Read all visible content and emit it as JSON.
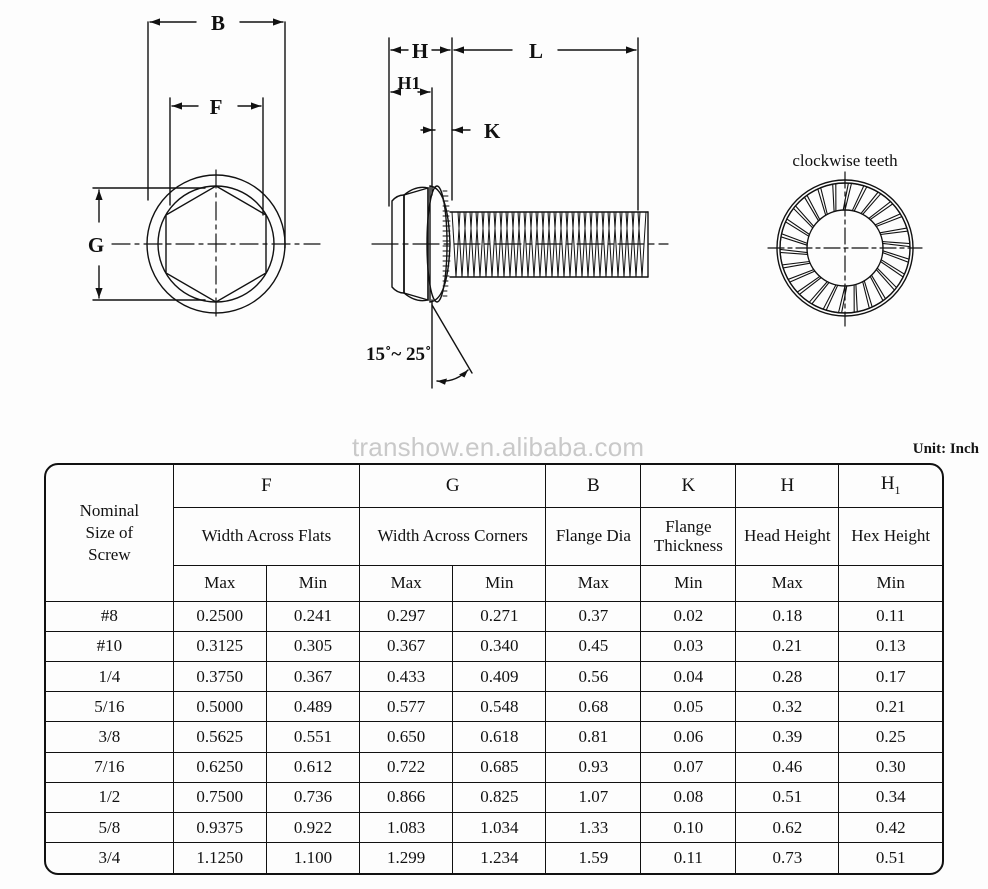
{
  "watermark": "transhow.en.alibaba.com",
  "unit_note": "Unit: Inch",
  "drawing": {
    "top_view": {
      "dim_b": "B",
      "dim_f": "F",
      "dim_g": "G"
    },
    "side_view": {
      "dim_h": "H",
      "dim_h1": "H1",
      "dim_l": "L",
      "dim_k": "K",
      "angle": "15˚~ 25˚"
    },
    "bottom_view": {
      "caption": "clockwise teeth"
    }
  },
  "table": {
    "symbols": [
      "",
      "F",
      "G",
      "B",
      "K",
      "H",
      "H1"
    ],
    "names": [
      "Nominal Size of Screw",
      "Width Across Flats",
      "Width Across Corners",
      "Flange Dia",
      "Flange Thickness",
      "Head Height",
      "Hex Height"
    ],
    "nominal_lines": [
      "Nominal",
      "Size of",
      "Screw"
    ],
    "flange_thickness_lines": [
      "Flange",
      "Thickness"
    ],
    "minmax": [
      "Max",
      "Min",
      "Max",
      "Min",
      "Max",
      "Min",
      "Max",
      "Min"
    ],
    "rows": [
      {
        "size": "#8",
        "f_max": "0.2500",
        "f_min": "0.241",
        "g_max": "0.297",
        "g_min": "0.271",
        "b_max": "0.37",
        "k_min": "0.02",
        "h_max": "0.18",
        "h1_min": "0.11"
      },
      {
        "size": "#10",
        "f_max": "0.3125",
        "f_min": "0.305",
        "g_max": "0.367",
        "g_min": "0.340",
        "b_max": "0.45",
        "k_min": "0.03",
        "h_max": "0.21",
        "h1_min": "0.13"
      },
      {
        "size": "1/4",
        "f_max": "0.3750",
        "f_min": "0.367",
        "g_max": "0.433",
        "g_min": "0.409",
        "b_max": "0.56",
        "k_min": "0.04",
        "h_max": "0.28",
        "h1_min": "0.17"
      },
      {
        "size": "5/16",
        "f_max": "0.5000",
        "f_min": "0.489",
        "g_max": "0.577",
        "g_min": "0.548",
        "b_max": "0.68",
        "k_min": "0.05",
        "h_max": "0.32",
        "h1_min": "0.21"
      },
      {
        "size": "3/8",
        "f_max": "0.5625",
        "f_min": "0.551",
        "g_max": "0.650",
        "g_min": "0.618",
        "b_max": "0.81",
        "k_min": "0.06",
        "h_max": "0.39",
        "h1_min": "0.25"
      },
      {
        "size": "7/16",
        "f_max": "0.6250",
        "f_min": "0.612",
        "g_max": "0.722",
        "g_min": "0.685",
        "b_max": "0.93",
        "k_min": "0.07",
        "h_max": "0.46",
        "h1_min": "0.30"
      },
      {
        "size": "1/2",
        "f_max": "0.7500",
        "f_min": "0.736",
        "g_max": "0.866",
        "g_min": "0.825",
        "b_max": "1.07",
        "k_min": "0.08",
        "h_max": "0.51",
        "h1_min": "0.34"
      },
      {
        "size": "5/8",
        "f_max": "0.9375",
        "f_min": "0.922",
        "g_max": "1.083",
        "g_min": "1.034",
        "b_max": "1.33",
        "k_min": "0.10",
        "h_max": "0.62",
        "h1_min": "0.42"
      },
      {
        "size": "3/4",
        "f_max": "1.1250",
        "f_min": "1.100",
        "g_max": "1.299",
        "g_min": "1.234",
        "b_max": "1.59",
        "k_min": "0.11",
        "h_max": "0.73",
        "h1_min": "0.51"
      }
    ]
  }
}
